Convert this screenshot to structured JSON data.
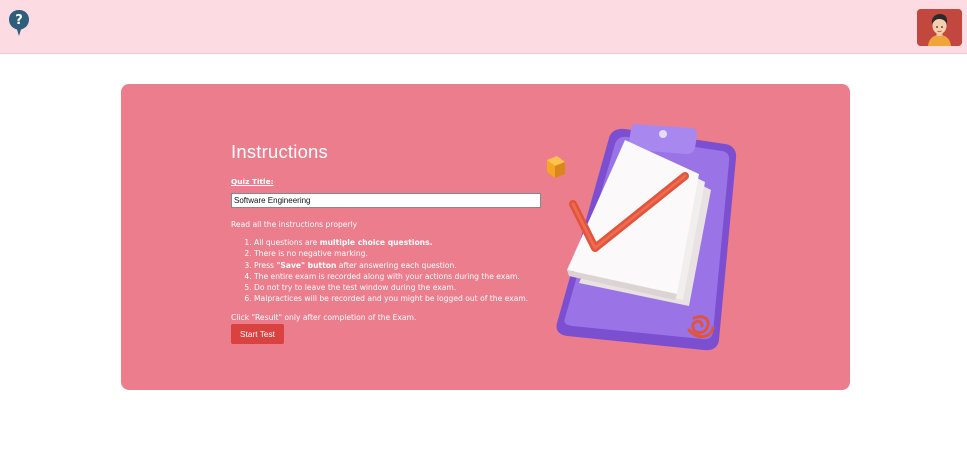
{
  "header": {
    "logo_icon": "help-question-icon",
    "avatar_icon": "user-avatar-icon"
  },
  "instructions": {
    "title": "Instructions",
    "quiz_title_label": "Quiz Title:",
    "quiz_title_value": "Software Engineering",
    "read_note": "Read all the instructions properly",
    "items": [
      {
        "before": "All questions are ",
        "bold": "multiple choice questions.",
        "after": ""
      },
      {
        "before": "There is no negative marking.",
        "bold": "",
        "after": ""
      },
      {
        "before": "Press ",
        "bold": "\"Save\" button",
        "after": " after answering each question."
      },
      {
        "before": "The entire exam is recorded along with your actions during the exam.",
        "bold": "",
        "after": ""
      },
      {
        "before": "Do not try to leave the test window during the exam.",
        "bold": "",
        "after": ""
      },
      {
        "before": "Malpractices will be recorded and you might be logged out of the exam.",
        "bold": "",
        "after": ""
      }
    ],
    "result_note": "Click \"Result\" only after completion of the Exam.",
    "start_button": "Start Test"
  },
  "colors": {
    "header_bg": "#fcdbe2",
    "card_bg": "#ec7d8d",
    "button_bg": "#d9423f",
    "avatar_bg": "#c2483f"
  }
}
